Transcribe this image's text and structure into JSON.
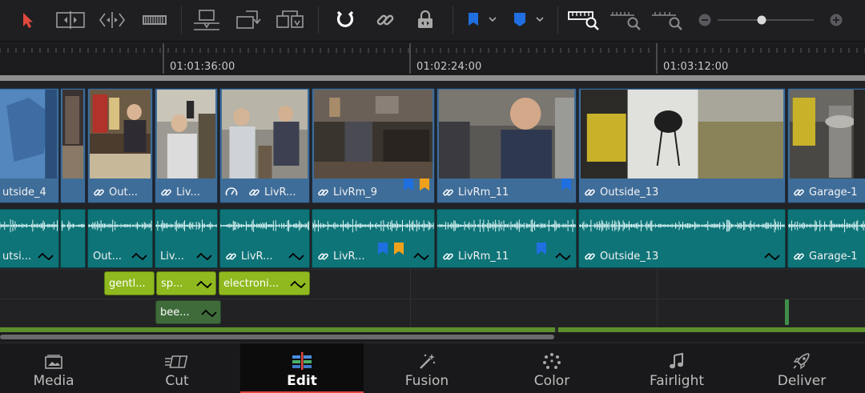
{
  "timeline": {
    "ruler": {
      "timecodes": [
        "01:01:36:00",
        "01:02:24:00",
        "01:03:12:00"
      ]
    },
    "video_clips": [
      {
        "label": "utside_4",
        "link": false,
        "speed": false
      },
      {
        "label": "",
        "link": false,
        "speed": false
      },
      {
        "label": "Out...",
        "link": true,
        "speed": false
      },
      {
        "label": "Liv...",
        "link": true,
        "speed": false
      },
      {
        "label": "LivR...",
        "link": true,
        "speed": true
      },
      {
        "label": "LivRm_9",
        "link": true,
        "speed": false
      },
      {
        "label": "LivRm_11",
        "link": true,
        "speed": false
      },
      {
        "label": "Outside_13",
        "link": true,
        "speed": false
      },
      {
        "label": "Garage-1",
        "link": true,
        "speed": false
      }
    ],
    "audio_clips": [
      {
        "label": "utsi..."
      },
      {
        "label": ""
      },
      {
        "label": "Out..."
      },
      {
        "label": "Liv..."
      },
      {
        "label": "LivR..."
      },
      {
        "label": "LivR..."
      },
      {
        "label": "LivRm_11"
      },
      {
        "label": "Outside_13"
      },
      {
        "label": "Garage-1"
      }
    ],
    "music_clips": [
      {
        "label": "gentl..."
      },
      {
        "label": "sp..."
      },
      {
        "label": "electroni..."
      }
    ],
    "sfx_clips": [
      {
        "label": "bee..."
      }
    ],
    "colors": {
      "video_clip": "#3f6d99",
      "audio_clip": "#0e7478",
      "music_clip": "#8fb91f",
      "sfx_clip": "#3f6b3b",
      "marker_blue": "#1f6fe0",
      "marker_orange": "#f0a11c",
      "active_page": "#e0483e"
    }
  },
  "pages": [
    {
      "label": "Media",
      "icon": "media-page-icon"
    },
    {
      "label": "Cut",
      "icon": "cut-page-icon"
    },
    {
      "label": "Edit",
      "icon": "edit-page-icon",
      "active": true
    },
    {
      "label": "Fusion",
      "icon": "fusion-page-icon"
    },
    {
      "label": "Color",
      "icon": "color-page-icon"
    },
    {
      "label": "Fairlight",
      "icon": "fairlight-page-icon"
    },
    {
      "label": "Deliver",
      "icon": "deliver-page-icon"
    }
  ]
}
